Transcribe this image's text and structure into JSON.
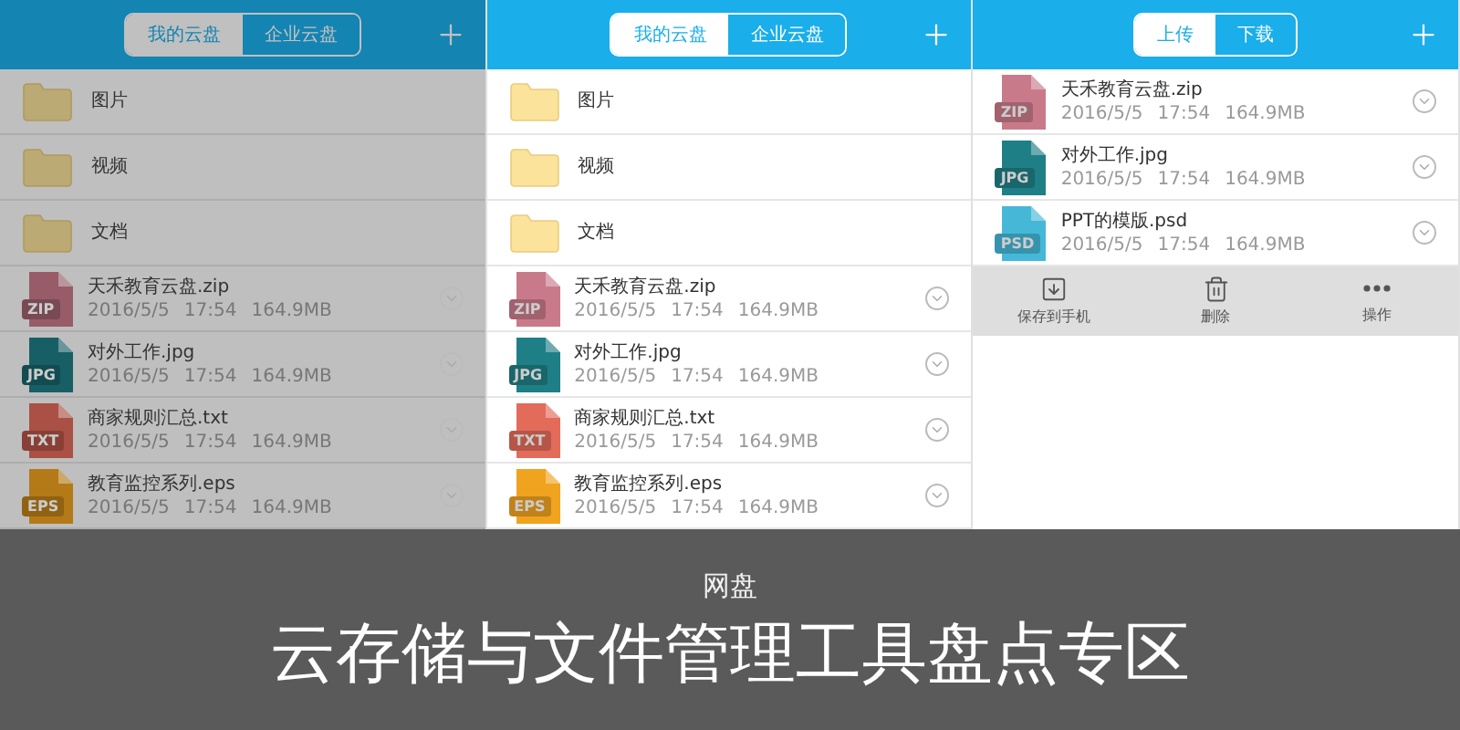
{
  "panels": [
    {
      "dimmed": true,
      "tabs": [
        {
          "label": "我的云盘",
          "selected": true
        },
        {
          "label": "企业云盘",
          "selected": false
        }
      ],
      "items": [
        {
          "kind": "folder",
          "name": "图片"
        },
        {
          "kind": "folder",
          "name": "视频"
        },
        {
          "kind": "folder",
          "name": "文档"
        },
        {
          "kind": "file",
          "name": "天禾教育云盘.zip",
          "type": "ZIP",
          "color": "#975c68",
          "date": "2016/5/5",
          "time": "17:54",
          "size": "164.9MB"
        },
        {
          "kind": "file",
          "name": "对外工作.jpg",
          "type": "JPG",
          "color": "#175f65",
          "date": "2016/5/5",
          "time": "17:54",
          "size": "164.9MB"
        },
        {
          "kind": "file",
          "name": "商家规则汇总.txt",
          "type": "TXT",
          "color": "#aa5044",
          "date": "2016/5/5",
          "time": "17:54",
          "size": "164.9MB"
        },
        {
          "kind": "file",
          "name": "教育监控系列.eps",
          "type": "EPS",
          "color": "#b47a17",
          "date": "2016/5/5",
          "time": "17:54",
          "size": "164.9MB"
        }
      ]
    },
    {
      "dimmed": false,
      "tabs": [
        {
          "label": "我的云盘",
          "selected": true
        },
        {
          "label": "企业云盘",
          "selected": false
        }
      ],
      "items": [
        {
          "kind": "folder",
          "name": "图片"
        },
        {
          "kind": "folder",
          "name": "视频"
        },
        {
          "kind": "folder",
          "name": "文档"
        },
        {
          "kind": "file",
          "name": "天禾教育云盘.zip",
          "type": "ZIP",
          "color": "#c97a8a",
          "date": "2016/5/5",
          "time": "17:54",
          "size": "164.9MB"
        },
        {
          "kind": "file",
          "name": "对外工作.jpg",
          "type": "JPG",
          "color": "#1f7f86",
          "date": "2016/5/5",
          "time": "17:54",
          "size": "164.9MB"
        },
        {
          "kind": "file",
          "name": "商家规则汇总.txt",
          "type": "TXT",
          "color": "#e36b5a",
          "date": "2016/5/5",
          "time": "17:54",
          "size": "164.9MB"
        },
        {
          "kind": "file",
          "name": "教育监控系列.eps",
          "type": "EPS",
          "color": "#f0a31f",
          "date": "2016/5/5",
          "time": "17:54",
          "size": "164.9MB"
        }
      ]
    },
    {
      "dimmed": false,
      "tabs": [
        {
          "label": "上传",
          "selected": true
        },
        {
          "label": "下载",
          "selected": false
        }
      ],
      "items": [
        {
          "kind": "file",
          "name": "天禾教育云盘.zip",
          "type": "ZIP",
          "color": "#c97a8a",
          "date": "2016/5/5",
          "time": "17:54",
          "size": "164.9MB"
        },
        {
          "kind": "file",
          "name": "对外工作.jpg",
          "type": "JPG",
          "color": "#1f7f86",
          "date": "2016/5/5",
          "time": "17:54",
          "size": "164.9MB"
        },
        {
          "kind": "file",
          "name": "PPT的模版.psd",
          "type": "PSD",
          "color": "#45b8d8",
          "date": "2016/5/5",
          "time": "17:54",
          "size": "164.9MB"
        }
      ],
      "actions": [
        {
          "kind": "save",
          "label": "保存到手机"
        },
        {
          "kind": "delete",
          "label": "删除"
        },
        {
          "kind": "more",
          "label": "操作"
        }
      ]
    }
  ],
  "banner": {
    "category": "网盘",
    "title": "云存储与文件管理工具盘点专区"
  }
}
